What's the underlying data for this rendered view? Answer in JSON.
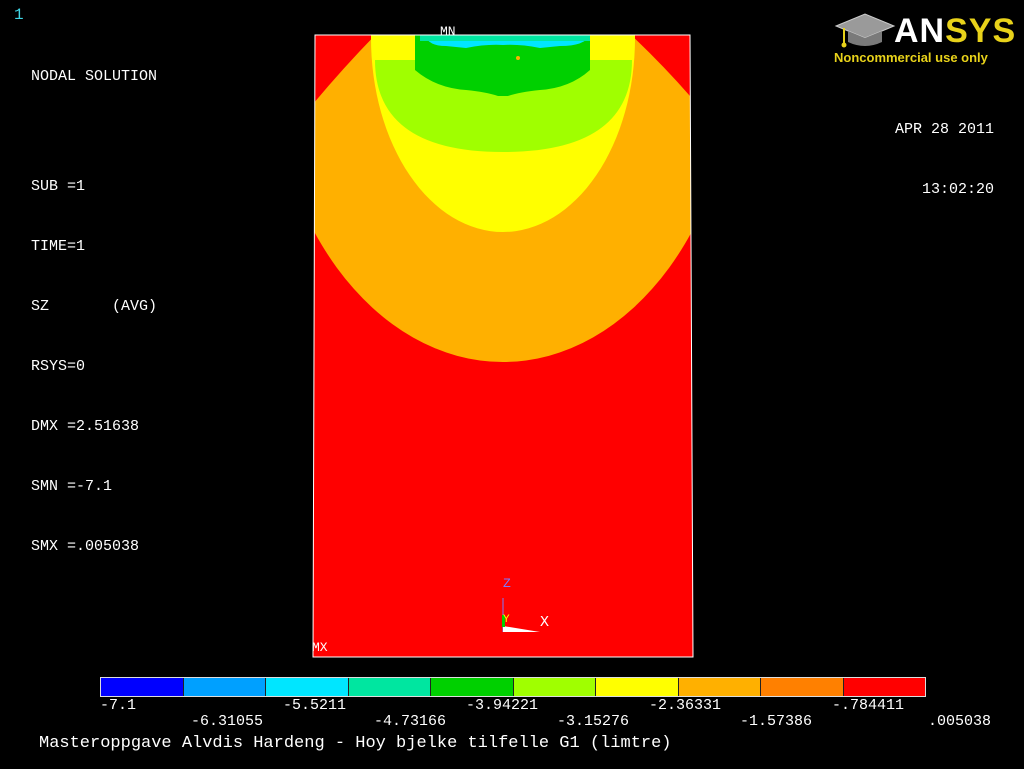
{
  "window_number": "1",
  "solution": {
    "title": "NODAL SOLUTION",
    "lines": [
      "SUB =1",
      "TIME=1",
      "SZ       (AVG)",
      "RSYS=0",
      "DMX =2.51638",
      "SMN =-7.1",
      "SMX =.005038"
    ]
  },
  "date": "APR 28 2011",
  "time": "13:02:20",
  "logo": {
    "word_a": "AN",
    "word_b": "SYS",
    "subtitle": "Noncommercial use only"
  },
  "markers": {
    "min_label": "MN",
    "max_label": "MX"
  },
  "triad": {
    "z": "Z",
    "y": "Y",
    "x": "X"
  },
  "legend": {
    "colors": [
      "#0000ff",
      "#00a0ff",
      "#00e6ff",
      "#00e6a0",
      "#00d000",
      "#a0ff00",
      "#ffff00",
      "#ffb000",
      "#ff8000",
      "#ff0000"
    ],
    "labels_top_row": [
      "-7.1",
      "-5.5211",
      "-3.94221",
      "-2.36331",
      "-.784411"
    ],
    "labels_bottom_row": [
      "-6.31055",
      "-4.73166",
      "-3.15276",
      "-1.57386",
      ".005038"
    ]
  },
  "footer_title": "Masteroppgave Alvdis Hardeng - Hoy bjelke tilfelle G1 (limtre)"
}
